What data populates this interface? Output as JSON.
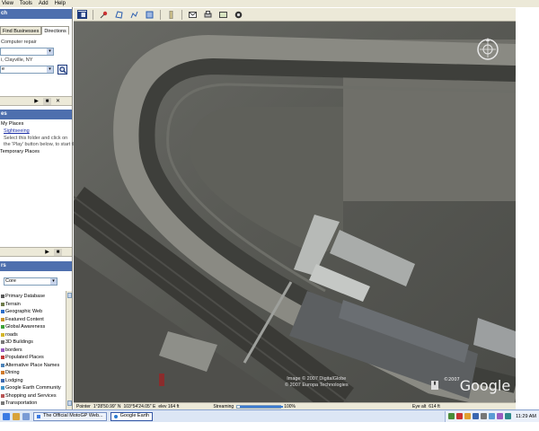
{
  "menu": [
    "View",
    "Tools",
    "Add",
    "Help"
  ],
  "toolbar_icons": [
    "sidebar-toggle-icon",
    "pushpin-icon",
    "polygon-icon",
    "path-icon",
    "overlay-icon",
    "ruler-icon",
    "email-icon",
    "print-icon",
    "map-view-icon",
    "web-icon"
  ],
  "search": {
    "header": "ch",
    "tabs": [
      "Find Businesses",
      "Directions"
    ],
    "hint": "Computer repair",
    "location": "i, Clayville, NY",
    "location2": "e"
  },
  "places": {
    "header": "es",
    "items": [
      {
        "label": "My Places"
      },
      {
        "label": "Sightseeing"
      },
      {
        "label": "Select this folder and click on"
      },
      {
        "label": "the 'Play' button below, to start th"
      },
      {
        "label": "Temporary Places"
      }
    ]
  },
  "layers": {
    "header": "rs",
    "db_select": "Core",
    "items": [
      {
        "label": "Primary Database",
        "color": "#5a5a5a"
      },
      {
        "label": "Terrain",
        "color": "#6e7b4a"
      },
      {
        "label": "Geographic Web",
        "color": "#2d6ec9"
      },
      {
        "label": "Featured Content",
        "color": "#c9932d"
      },
      {
        "label": "Global Awareness",
        "color": "#3ea23a"
      },
      {
        "label": "roads",
        "color": "#d4b62a"
      },
      {
        "label": "3D Buildings",
        "color": "#777777"
      },
      {
        "label": "borders",
        "color": "#9a5cc0"
      },
      {
        "label": "Populated Places",
        "color": "#c23b3b"
      },
      {
        "label": "Alternative Place Names",
        "color": "#4d83b8"
      },
      {
        "label": "Dining",
        "color": "#d07a2b"
      },
      {
        "label": "Lodging",
        "color": "#3c6ab0"
      },
      {
        "label": "Google Earth Community",
        "color": "#3f94c9"
      },
      {
        "label": "Shopping and Services",
        "color": "#b95555"
      },
      {
        "label": "Transportation",
        "color": "#777777"
      }
    ]
  },
  "map": {
    "credit_line1": "Image © 2007 DigitalGlobe",
    "credit_line2": "© 2007 Europa Technologies",
    "logo_prefix": "©2007",
    "logo_text": "Google"
  },
  "status": {
    "pointer_label": "Pointer",
    "lat": "1°28'50.99\" N",
    "lon": "103°54'24.05\" E",
    "elev": "elev   164 ft",
    "streaming_label": "Streaming",
    "streaming_pct": "100%",
    "streaming_fraction": 1.0,
    "eye_alt": "Eye alt",
    "eye_alt_value": "614 ft"
  },
  "taskbar": {
    "tasks": [
      {
        "label": "The Official MotoGP Web..."
      },
      {
        "label": "Google Earth"
      }
    ],
    "active_index": 1,
    "clock": "11:29 AM"
  }
}
